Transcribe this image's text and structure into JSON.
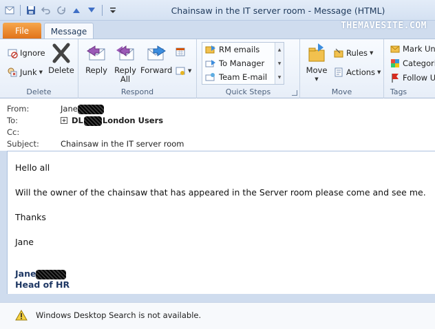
{
  "window": {
    "title": "Chainsaw in the IT server room  -  Message (HTML)",
    "watermark": "THEMAVESITE.COM"
  },
  "tabs": {
    "file": "File",
    "message": "Message"
  },
  "ribbon": {
    "delete_group": {
      "label": "Delete",
      "ignore": "Ignore",
      "junk": "Junk",
      "delete": "Delete"
    },
    "respond_group": {
      "label": "Respond",
      "reply": "Reply",
      "reply_all_line1": "Reply",
      "reply_all_line2": "All",
      "forward": "Forward"
    },
    "quick_steps_group": {
      "label": "Quick Steps",
      "items": [
        "RM emails",
        "To Manager",
        "Team E-mail"
      ]
    },
    "move_group": {
      "label": "Move",
      "move": "Move",
      "rules": "Rules",
      "actions": "Actions"
    },
    "tags_group": {
      "label": "Tags",
      "mark_unread": "Mark Unr",
      "categorize": "Categoriz",
      "follow_up": "Follow U"
    }
  },
  "header": {
    "from_label": "From:",
    "from_value": "Jane",
    "to_label": "To:",
    "to_value_prefix": "DL",
    "to_value_suffix": "London Users",
    "cc_label": "Cc:",
    "subject_label": "Subject:",
    "subject_value": "Chainsaw in the IT server room"
  },
  "body": {
    "greeting": "Hello all",
    "line1": "Will the owner of the chainsaw that has appeared in the Server room please come and see me.",
    "thanks": "Thanks",
    "name": "Jane",
    "sig_name": "Jane",
    "sig_title": "Head of HR"
  },
  "infobar": {
    "text": "Windows Desktop Search is not available."
  },
  "colors": {
    "file_tab": "#e1731a",
    "signature": "#1f3864",
    "ribbon_bg": "#e7eef8"
  }
}
